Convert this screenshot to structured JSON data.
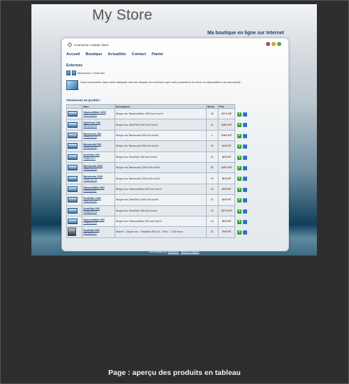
{
  "logo": "My Store",
  "tagline": "Ma boutique en ligne sur Internet",
  "login_link": "Connexion compte client",
  "flags": [
    {
      "name": "uk-flag-icon",
      "color": "#b84a5a"
    },
    {
      "name": "es-flag-icon",
      "color": "#d6a23a"
    },
    {
      "name": "it-flag-icon",
      "color": "#5aa84a"
    }
  ],
  "nav": [
    "Accueil",
    "Boutique",
    "Actualités",
    "Contact",
    "Panier"
  ],
  "section_title": "Externes",
  "breadcrumb": "Bienvenue » Externes",
  "intro_text": "Vous retrouverez dans cette catégorie tous les disques dur externes que nous possédons en stock ou disponibles à la commande.",
  "choose_label": "Choisissez un produit :",
  "table": {
    "headers": [
      "",
      "Nom",
      "Description",
      "Stock",
      "Prix",
      ""
    ],
    "rows": [
      {
        "name": "DiamondMax 1000",
        "ref": "P027-03-21",
        "desc": "Disque dur DiamondMax 1000 ko/h ko/rh/",
        "stock": "39",
        "price": "117 € HT"
      },
      {
        "name": "SpinPoint 250",
        "ref": "P470-03-23",
        "desc": "Disque dur SpinPoint 250 ko/h ko/rh/",
        "stock": "41",
        "price": "115 € HT"
      },
      {
        "name": "Barracuda 250",
        "ref": "P348-03-23",
        "desc": "Disque dur Barracuda 250 ko/h ko/rh/",
        "stock": "1",
        "price": "118 € HT"
      },
      {
        "name": "Barracuda 500",
        "ref": "P238-03-34",
        "desc": "Disque dur Barracuda 500 ko/h ko/rh/",
        "stock": "10",
        "price": "64 € HT"
      },
      {
        "name": "DeskStar 500",
        "ref": "P468-02-2",
        "desc": "Disque dur DeskStar 500 ko/h ko/rh/",
        "stock": "41",
        "price": "49 € HT"
      },
      {
        "name": "Barracuda 1000",
        "ref": "P182-03-23",
        "desc": "Disque dur Barracuda 1000 ko/h ko/rh/",
        "stock": "50",
        "price": "140 € HT"
      },
      {
        "name": "Barracuda 1000",
        "ref": "P368-03-25",
        "desc": "Disque dur Barracuda 1000 ko/h ko/rh/",
        "stock": "15",
        "price": "50 € HT"
      },
      {
        "name": "DiamondMax 500",
        "ref": "P110-03-22",
        "desc": "Disque dur DiamondMax 500 ko/h ko/rh/",
        "stock": "39",
        "price": "29 € HT"
      },
      {
        "name": "DeskStar 1000",
        "ref": "P601-03-18",
        "desc": "Disque dur DeskStar 1000 ko/h ko/rh/",
        "stock": "21",
        "price": "54 € HT"
      },
      {
        "name": "DeskStar 250",
        "ref": "P148-03-16",
        "desc": "Disque dur DeskStar 250 ko/h ko/rh/",
        "stock": "19",
        "price": "137 € HT"
      },
      {
        "name": "DiamondMax 250",
        "ref": "P498-03-19",
        "desc": "Disque dur DiamondMax 250 ko/h ko/rh/",
        "stock": "13",
        "price": "49 € HT"
      },
      {
        "name": "DeskStar 500",
        "ref": "P479-03-17",
        "desc": "Hitachi - Disque dur - Deskstar 500 Go - 8 Mo - 7 200 tours",
        "stock": "32",
        "price": "79 € HT"
      }
    ]
  },
  "footer": {
    "prefix": "Site hébergé par",
    "link1": "Webcanut",
    "sep": " - ",
    "link2": "Mentions légales"
  },
  "caption": "Page : aperçu des produits en tableau"
}
